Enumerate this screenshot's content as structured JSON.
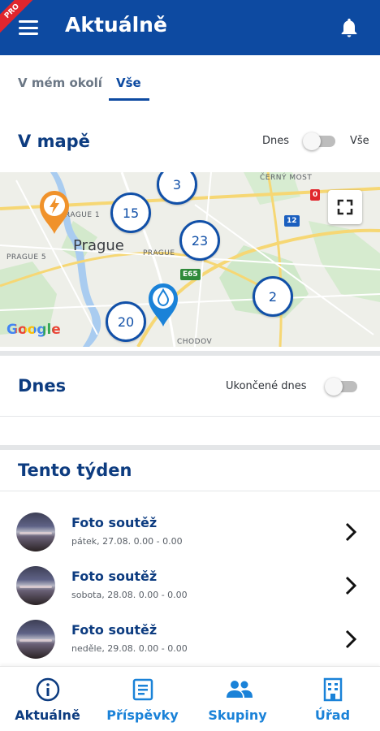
{
  "app_bar": {
    "title": "Aktuálně",
    "ribbon": "PRO"
  },
  "tabs": [
    {
      "label": "V mém okolí",
      "active": false
    },
    {
      "label": "Vše",
      "active": true
    }
  ],
  "map_section": {
    "title": "V mapě",
    "toggle_left_label": "Dnes",
    "toggle_right_label": "Vše",
    "toggle_on": false
  },
  "map": {
    "city": "Prague",
    "labels": [
      "ČERNÝ MOST",
      "PRAGUE 1",
      "PRAGUE 5",
      "PRAGUE",
      "CHODOV"
    ],
    "road_badges": [
      "0",
      "12",
      "E65"
    ],
    "clusters": [
      "3",
      "15",
      "23",
      "2",
      "20"
    ],
    "pins": [
      {
        "type": "lightning-pin",
        "color": "#f0922b"
      },
      {
        "type": "water-pin",
        "color": "#1a82d8"
      }
    ],
    "attribution": "Google"
  },
  "today_section": {
    "title": "Dnes",
    "toggle_label": "Ukončené dnes",
    "toggle_on": false
  },
  "week_section": {
    "title": "Tento týden",
    "items": [
      {
        "title": "Foto soutěž",
        "date": "pátek, 27.08. 0.00 - 0.00"
      },
      {
        "title": "Foto soutěž",
        "date": "sobota, 28.08. 0.00 - 0.00"
      },
      {
        "title": "Foto soutěž",
        "date": "neděle, 29.08. 0.00 - 0.00"
      }
    ]
  },
  "bottom_nav": [
    {
      "label": "Aktuálně",
      "icon": "info-icon",
      "color": "#0d3c80"
    },
    {
      "label": "Příspěvky",
      "icon": "document-icon",
      "color": "#1a82d8"
    },
    {
      "label": "Skupiny",
      "icon": "people-icon",
      "color": "#1a82d8"
    },
    {
      "label": "Úřad",
      "icon": "building-icon",
      "color": "#1a82d8"
    }
  ],
  "colors": {
    "primary": "#0d4aa1",
    "title": "#0d3c80",
    "accent": "#1a82d8"
  }
}
